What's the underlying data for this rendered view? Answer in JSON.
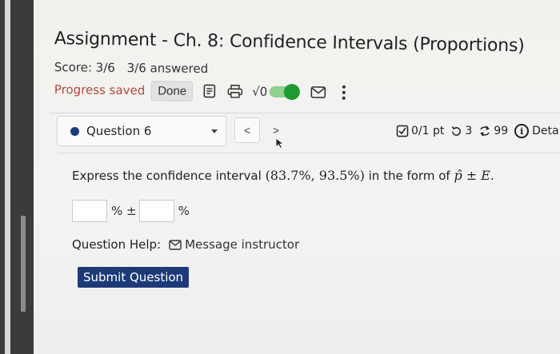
{
  "assignment": {
    "title": "Assignment - Ch. 8: Confidence Intervals (Proportions)",
    "score": "Score: 3/6",
    "answered": "3/6 answered",
    "progress_saved": "Progress saved",
    "done_label": "Done",
    "sqrt_label": "√0"
  },
  "question": {
    "selector_label": "Question 6",
    "prev_label": "<",
    "next_label": ">",
    "points": "0/1 pt",
    "retries": "3",
    "attempts": "99",
    "details_label": "Deta",
    "prompt_prefix": "Express the confidence interval ",
    "interval": "(83.7%, 93.5%)",
    "prompt_middle": " in the form of ",
    "form_phat": "p̂",
    "form_pm": " ± ",
    "form_E": "E",
    "form_end": ".",
    "pct_pm": "% ±",
    "pct": "%",
    "help_label": "Question Help:",
    "message_instructor": "Message instructor",
    "submit_label": "Submit Question"
  },
  "colors": {
    "accent": "#1d3a78",
    "progress": "#b04a3a",
    "toggle_on": "#1e9a2e"
  },
  "icons": [
    "document-icon",
    "print-icon",
    "toggle-icon",
    "mail-icon",
    "more-vertical-icon",
    "checkbox-icon",
    "retry-icon",
    "attempts-icon",
    "info-icon",
    "cursor-icon"
  ]
}
